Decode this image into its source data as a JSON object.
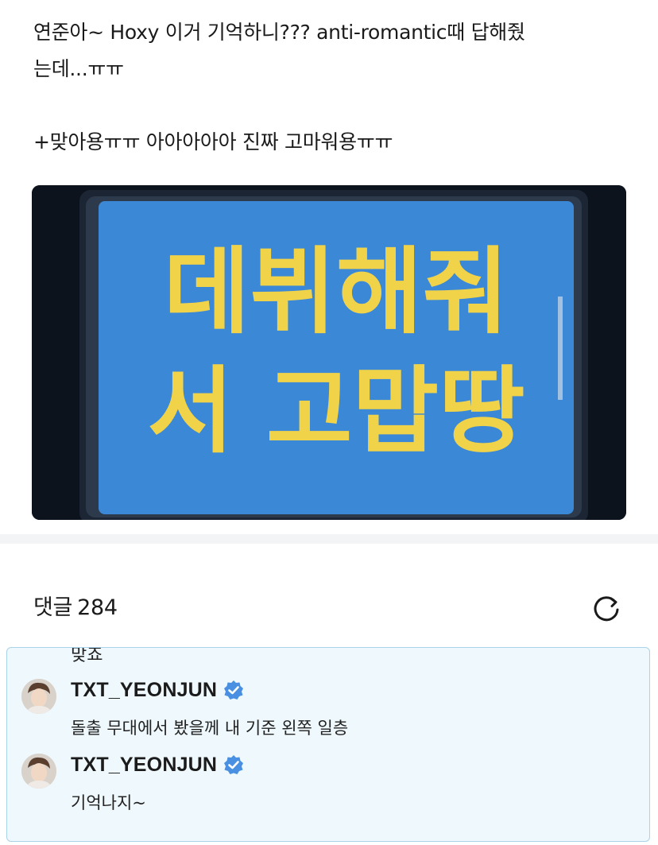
{
  "post": {
    "line1": "연준아~ Hoxy 이거 기억하니??? anti-romantic때 답해줬",
    "line2": "는데...ㅠㅠ",
    "line3": "+맞아용ㅠㅠ 아아아아아 진짜 고마워용ㅠㅠ",
    "photo": {
      "sign_line1": "데뷔해줘",
      "sign_line2": "서 고맙땅",
      "sign_background": "#3b88d6",
      "sign_text_color": "#f1d34a"
    }
  },
  "comments": {
    "title": "댓글",
    "count": "284",
    "refresh_icon": "refresh-icon",
    "thread": {
      "previous_reply_text": "맞죠",
      "items": [
        {
          "username": "TXT_YEONJUN",
          "verified": true,
          "text": "돌출 무대에서 봤을께 내 기준 왼쪽 일층"
        },
        {
          "username": "TXT_YEONJUN",
          "verified": true,
          "text": "기억나지~"
        }
      ]
    },
    "accent_color": "#4a90e2"
  }
}
